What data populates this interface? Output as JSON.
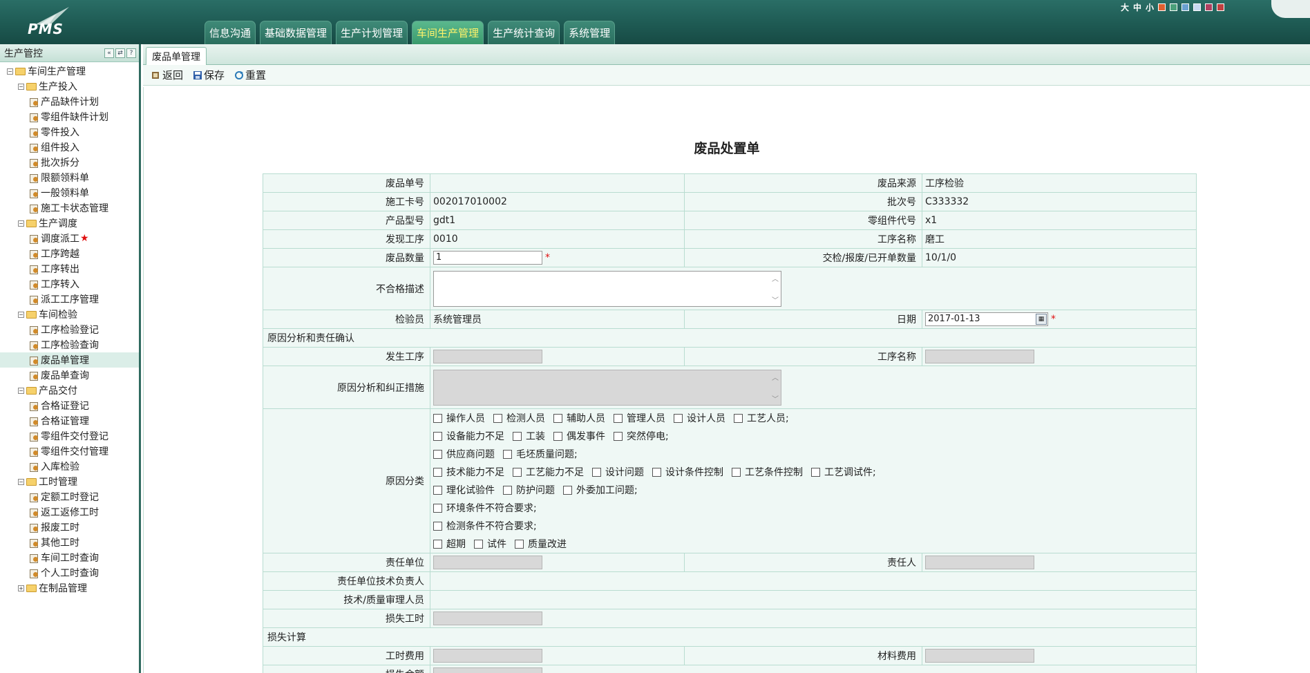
{
  "header": {
    "logo_text": "PMS",
    "nav": [
      "信息沟通",
      "基础数据管理",
      "生产计划管理",
      "车间生产管理",
      "生产统计查询",
      "系统管理"
    ],
    "active_nav": "车间生产管理",
    "font_sizes": [
      "大",
      "中",
      "小"
    ],
    "theme_colors": [
      "#e06030",
      "#4aa07a",
      "#6aa0d0",
      "#c8d8f0",
      "#b04060",
      "#c04040"
    ]
  },
  "sidebar": {
    "title": "生产管控",
    "tree": [
      {
        "label": "车间生产管理",
        "level": 0,
        "type": "folder",
        "expanded": true
      },
      {
        "label": "生产投入",
        "level": 1,
        "type": "folder",
        "expanded": true
      },
      {
        "label": "产品缺件计划",
        "level": 2,
        "type": "leaf"
      },
      {
        "label": "零组件缺件计划",
        "level": 2,
        "type": "leaf"
      },
      {
        "label": "零件投入",
        "level": 2,
        "type": "leaf"
      },
      {
        "label": "组件投入",
        "level": 2,
        "type": "leaf"
      },
      {
        "label": "批次拆分",
        "level": 2,
        "type": "leaf"
      },
      {
        "label": "限额领料单",
        "level": 2,
        "type": "leaf"
      },
      {
        "label": "一般领料单",
        "level": 2,
        "type": "leaf"
      },
      {
        "label": "施工卡状态管理",
        "level": 2,
        "type": "leaf"
      },
      {
        "label": "生产调度",
        "level": 1,
        "type": "folder",
        "expanded": true
      },
      {
        "label": "调度派工",
        "level": 2,
        "type": "leaf",
        "star": "★"
      },
      {
        "label": "工序跨越",
        "level": 2,
        "type": "leaf"
      },
      {
        "label": "工序转出",
        "level": 2,
        "type": "leaf"
      },
      {
        "label": "工序转入",
        "level": 2,
        "type": "leaf"
      },
      {
        "label": "派工工序管理",
        "level": 2,
        "type": "leaf"
      },
      {
        "label": "车间检验",
        "level": 1,
        "type": "folder",
        "expanded": true
      },
      {
        "label": "工序检验登记",
        "level": 2,
        "type": "leaf"
      },
      {
        "label": "工序检验查询",
        "level": 2,
        "type": "leaf"
      },
      {
        "label": "废品单管理",
        "level": 2,
        "type": "leaf",
        "selected": true
      },
      {
        "label": "废品单查询",
        "level": 2,
        "type": "leaf"
      },
      {
        "label": "产品交付",
        "level": 1,
        "type": "folder",
        "expanded": true
      },
      {
        "label": "合格证登记",
        "level": 2,
        "type": "leaf"
      },
      {
        "label": "合格证管理",
        "level": 2,
        "type": "leaf"
      },
      {
        "label": "零组件交付登记",
        "level": 2,
        "type": "leaf"
      },
      {
        "label": "零组件交付管理",
        "level": 2,
        "type": "leaf"
      },
      {
        "label": "入库检验",
        "level": 2,
        "type": "leaf"
      },
      {
        "label": "工时管理",
        "level": 1,
        "type": "folder",
        "expanded": true
      },
      {
        "label": "定额工时登记",
        "level": 2,
        "type": "leaf"
      },
      {
        "label": "返工返修工时",
        "level": 2,
        "type": "leaf"
      },
      {
        "label": "报废工时",
        "level": 2,
        "type": "leaf"
      },
      {
        "label": "其他工时",
        "level": 2,
        "type": "leaf"
      },
      {
        "label": "车间工时查询",
        "level": 2,
        "type": "leaf"
      },
      {
        "label": "个人工时查询",
        "level": 2,
        "type": "leaf"
      },
      {
        "label": "在制品管理",
        "level": 1,
        "type": "folder",
        "expanded": false
      }
    ]
  },
  "tab": {
    "label": "废品单管理"
  },
  "toolbar": {
    "back": "返回",
    "save": "保存",
    "reset": "重置"
  },
  "form": {
    "title": "废品处置单",
    "scrap_no_label": "废品单号",
    "scrap_no": "",
    "source_label": "废品来源",
    "source": "工序检验",
    "card_no_label": "施工卡号",
    "card_no": "002017010002",
    "batch_label": "批次号",
    "batch": "C333332",
    "model_label": "产品型号",
    "model": "gdt1",
    "part_code_label": "零组件代号",
    "part_code": "x1",
    "found_proc_label": "发现工序",
    "found_proc": "0010",
    "proc_name_label": "工序名称",
    "proc_name": "磨工",
    "qty_label": "废品数量",
    "qty": "1",
    "counts_label": "交检/报废/已开单数量",
    "counts": "10/1/0",
    "nonconform_label": "不合格描述",
    "inspector_label": "检验员",
    "inspector": "系统管理员",
    "date_label": "日期",
    "date": "2017-01-13",
    "analysis_section": "原因分析和责任确认",
    "occur_proc_label": "发生工序",
    "occur_proc_name_label": "工序名称",
    "measure_label": "原因分析和纠正措施",
    "reason_label": "原因分类",
    "reason_lines": [
      [
        "操作人员",
        "检测人员",
        "辅助人员",
        "管理人员",
        "设计人员",
        "工艺人员;"
      ],
      [
        "设备能力不足",
        "工装",
        "偶发事件",
        "突然停电;"
      ],
      [
        "供应商问题",
        "毛坯质量问题;"
      ],
      [
        "技术能力不足",
        "工艺能力不足",
        "设计问题",
        "设计条件控制",
        "工艺条件控制",
        "工艺调试件;"
      ],
      [
        "理化试验件",
        "防护问题",
        "外委加工问题;"
      ],
      [
        "环境条件不符合要求;"
      ],
      [
        "检测条件不符合要求;"
      ],
      [
        "超期",
        "试件",
        "质量改进"
      ]
    ],
    "resp_unit_label": "责任单位",
    "resp_person_label": "责任人",
    "tech_lead_label": "责任单位技术负责人",
    "reviewer_label": "技术/质量审理人员",
    "lost_hours_label": "损失工时",
    "loss_section": "损失计算",
    "labor_cost_label": "工时费用",
    "material_cost_label": "材料费用",
    "loss_amount_label": "损失金额",
    "required_mark": "*"
  }
}
